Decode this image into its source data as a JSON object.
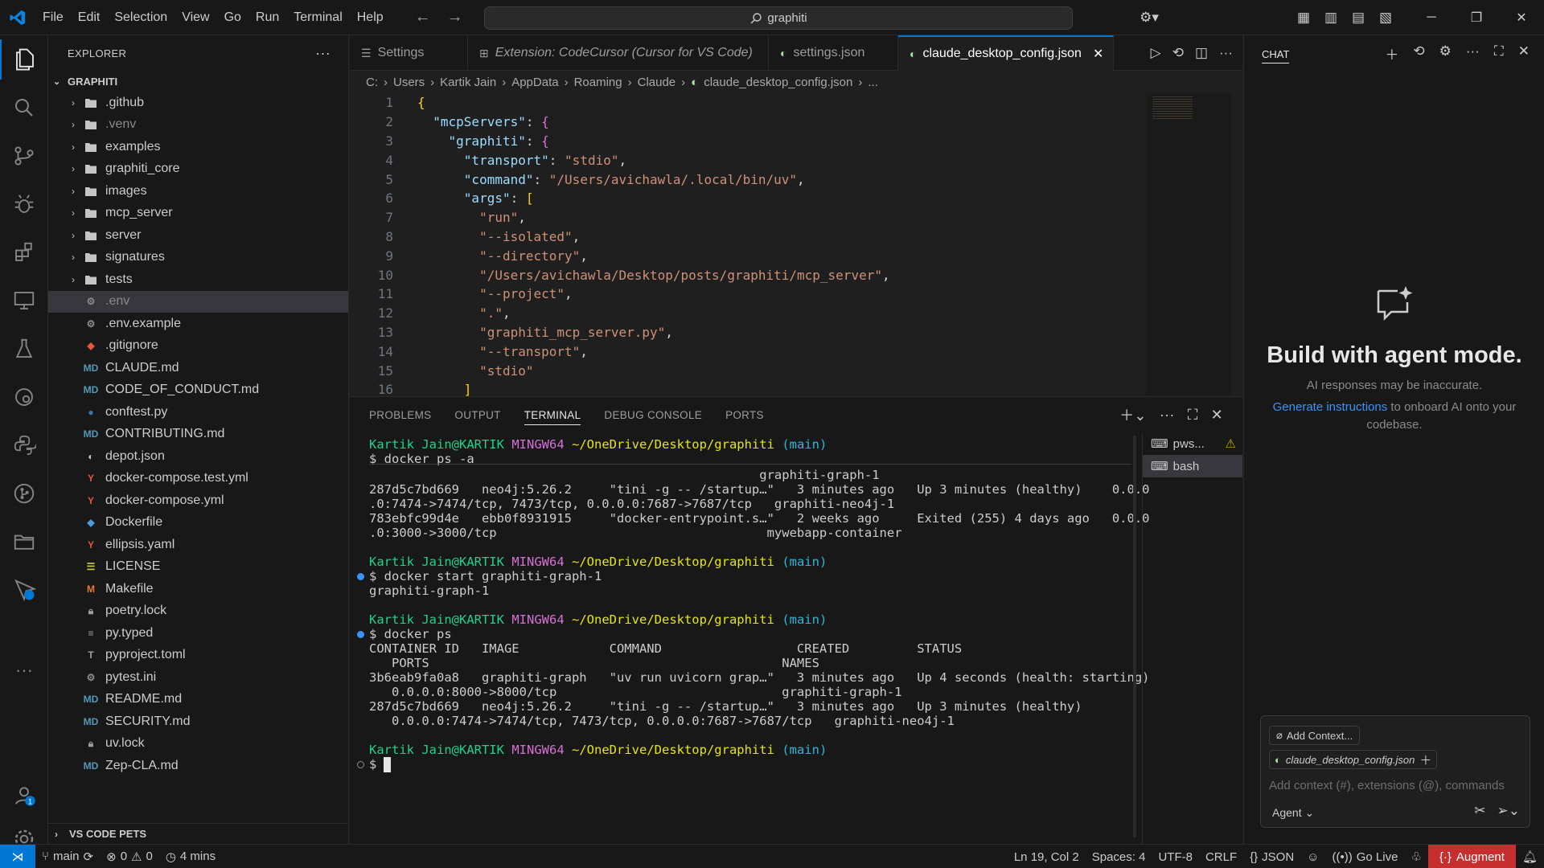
{
  "menu": [
    "File",
    "Edit",
    "Selection",
    "View",
    "Go",
    "Run",
    "Terminal",
    "Help"
  ],
  "search": {
    "text": "graphiti"
  },
  "explorer": {
    "header": "EXPLORER",
    "root": "GRAPHITI",
    "folders": [
      ".github",
      ".venv",
      "examples",
      "graphiti_core",
      "images",
      "mcp_server",
      "server",
      "signatures",
      "tests"
    ],
    "files": [
      {
        "name": ".env",
        "icon": "gear",
        "dim": true
      },
      {
        "name": ".env.example",
        "icon": "gear"
      },
      {
        "name": ".gitignore",
        "icon": "git"
      },
      {
        "name": "CLAUDE.md",
        "icon": "md"
      },
      {
        "name": "CODE_OF_CONDUCT.md",
        "icon": "md"
      },
      {
        "name": "conftest.py",
        "icon": "py"
      },
      {
        "name": "CONTRIBUTING.md",
        "icon": "md"
      },
      {
        "name": "depot.json",
        "icon": "json"
      },
      {
        "name": "docker-compose.test.yml",
        "icon": "yml"
      },
      {
        "name": "docker-compose.yml",
        "icon": "yml"
      },
      {
        "name": "Dockerfile",
        "icon": "docker"
      },
      {
        "name": "ellipsis.yaml",
        "icon": "yml"
      },
      {
        "name": "LICENSE",
        "icon": "license"
      },
      {
        "name": "Makefile",
        "icon": "make"
      },
      {
        "name": "poetry.lock",
        "icon": "lock"
      },
      {
        "name": "py.typed",
        "icon": "txt"
      },
      {
        "name": "pyproject.toml",
        "icon": "toml"
      },
      {
        "name": "pytest.ini",
        "icon": "gear"
      },
      {
        "name": "README.md",
        "icon": "md"
      },
      {
        "name": "SECURITY.md",
        "icon": "md"
      },
      {
        "name": "uv.lock",
        "icon": "lock"
      },
      {
        "name": "Zep-CLA.md",
        "icon": "md"
      }
    ],
    "pets_section": "VS CODE PETS"
  },
  "tabs": [
    {
      "label": "Settings",
      "icon": "settings"
    },
    {
      "label": "Extension: CodeCursor (Cursor for VS Code)",
      "icon": "extension",
      "italic": true
    },
    {
      "label": "settings.json",
      "icon": "json"
    },
    {
      "label": "claude_desktop_config.json",
      "icon": "json",
      "active": true
    }
  ],
  "breadcrumb": [
    "C:",
    "Users",
    "Kartik Jain",
    "AppData",
    "Roaming",
    "Claude",
    "claude_desktop_config.json",
    "..."
  ],
  "code": [
    {
      "n": "1",
      "t": "{"
    },
    {
      "n": "2",
      "t": "  \"mcpServers\": {"
    },
    {
      "n": "3",
      "t": "    \"graphiti\": {"
    },
    {
      "n": "4",
      "t": "      \"transport\": \"stdio\","
    },
    {
      "n": "5",
      "t": "      \"command\": \"/Users/avichawla/.local/bin/uv\","
    },
    {
      "n": "6",
      "t": "      \"args\": ["
    },
    {
      "n": "7",
      "t": "        \"run\","
    },
    {
      "n": "8",
      "t": "        \"--isolated\","
    },
    {
      "n": "9",
      "t": "        \"--directory\","
    },
    {
      "n": "10",
      "t": "        \"/Users/avichawla/Desktop/posts/graphiti/mcp_server\","
    },
    {
      "n": "11",
      "t": "        \"--project\","
    },
    {
      "n": "12",
      "t": "        \".\","
    },
    {
      "n": "13",
      "t": "        \"graphiti_mcp_server.py\","
    },
    {
      "n": "14",
      "t": "        \"--transport\","
    },
    {
      "n": "15",
      "t": "        \"stdio\""
    },
    {
      "n": "16",
      "t": "      ]"
    }
  ],
  "panel": {
    "tabs": [
      "PROBLEMS",
      "OUTPUT",
      "TERMINAL",
      "DEBUG CONSOLE",
      "PORTS"
    ],
    "active_tab": "TERMINAL",
    "terminals": [
      "pws...",
      "bash"
    ]
  },
  "terminal": {
    "prompt_user": "Kartik Jain@KARTIK",
    "prompt_shell": "MINGW64",
    "prompt_path": "~/OneDrive/Desktop/graphiti",
    "prompt_branch": "(main)",
    "lines": {
      "c1": "$ docker ps -a",
      "l1": "                                                    graphiti-graph-1",
      "l2": "287d5c7bd669   neo4j:5.26.2     \"tini -g -- /startup…\"   3 minutes ago   Up 3 minutes (healthy)    0.0.0",
      "l3": ".0:7474->7474/tcp, 7473/tcp, 0.0.0.0:7687->7687/tcp   graphiti-neo4j-1",
      "l4": "783ebfc99d4e   ebb0f8931915     \"docker-entrypoint.s…\"   2 weeks ago     Exited (255) 4 days ago   0.0.0",
      "l5": ".0:3000->3000/tcp                                    mywebapp-container",
      "c2": "$ docker start graphiti-graph-1",
      "l6": "graphiti-graph-1",
      "c3": "$ docker ps",
      "l7": "CONTAINER ID   IMAGE            COMMAND                  CREATED         STATUS",
      "l8": "   PORTS                                               NAMES",
      "l9": "3b6eab9fa0a8   graphiti-graph   \"uv run uvicorn grap…\"   3 minutes ago   Up 4 seconds (health: starting)",
      "l10": "   0.0.0.0:8000->8000/tcp                              graphiti-graph-1",
      "l11": "287d5c7bd669   neo4j:5.26.2     \"tini -g -- /startup…\"   3 minutes ago   Up 3 minutes (healthy)",
      "l12": "   0.0.0.0:7474->7474/tcp, 7473/tcp, 0.0.0.0:7687->7687/tcp   graphiti-neo4j-1",
      "c4": "$ "
    }
  },
  "chat": {
    "header": "CHAT",
    "title": "Build with agent mode.",
    "subtitle": "AI responses may be inaccurate.",
    "link": "Generate instructions",
    "link_rest": " to onboard AI onto your codebase.",
    "add_context": "Add Context...",
    "context_file": "claude_desktop_config.json",
    "placeholder": "Add context (#), extensions (@), commands",
    "mode": "Agent"
  },
  "status": {
    "branch": "main",
    "errors": "0",
    "warnings": "0",
    "time": "4 mins",
    "position": "Ln 19, Col 2",
    "spaces": "Spaces: 4",
    "encoding": "UTF-8",
    "eol": "CRLF",
    "language": "JSON",
    "golive": "Go Live",
    "augment": "Augment"
  },
  "accounts_badge": "1",
  "colors": {
    "accent": "#0078d4",
    "augment": "#c72e2e",
    "prompt_green": "#23d18b",
    "prompt_purple": "#d670d6",
    "prompt_yellow": "#e5e510",
    "prompt_cyan": "#29b8db"
  }
}
